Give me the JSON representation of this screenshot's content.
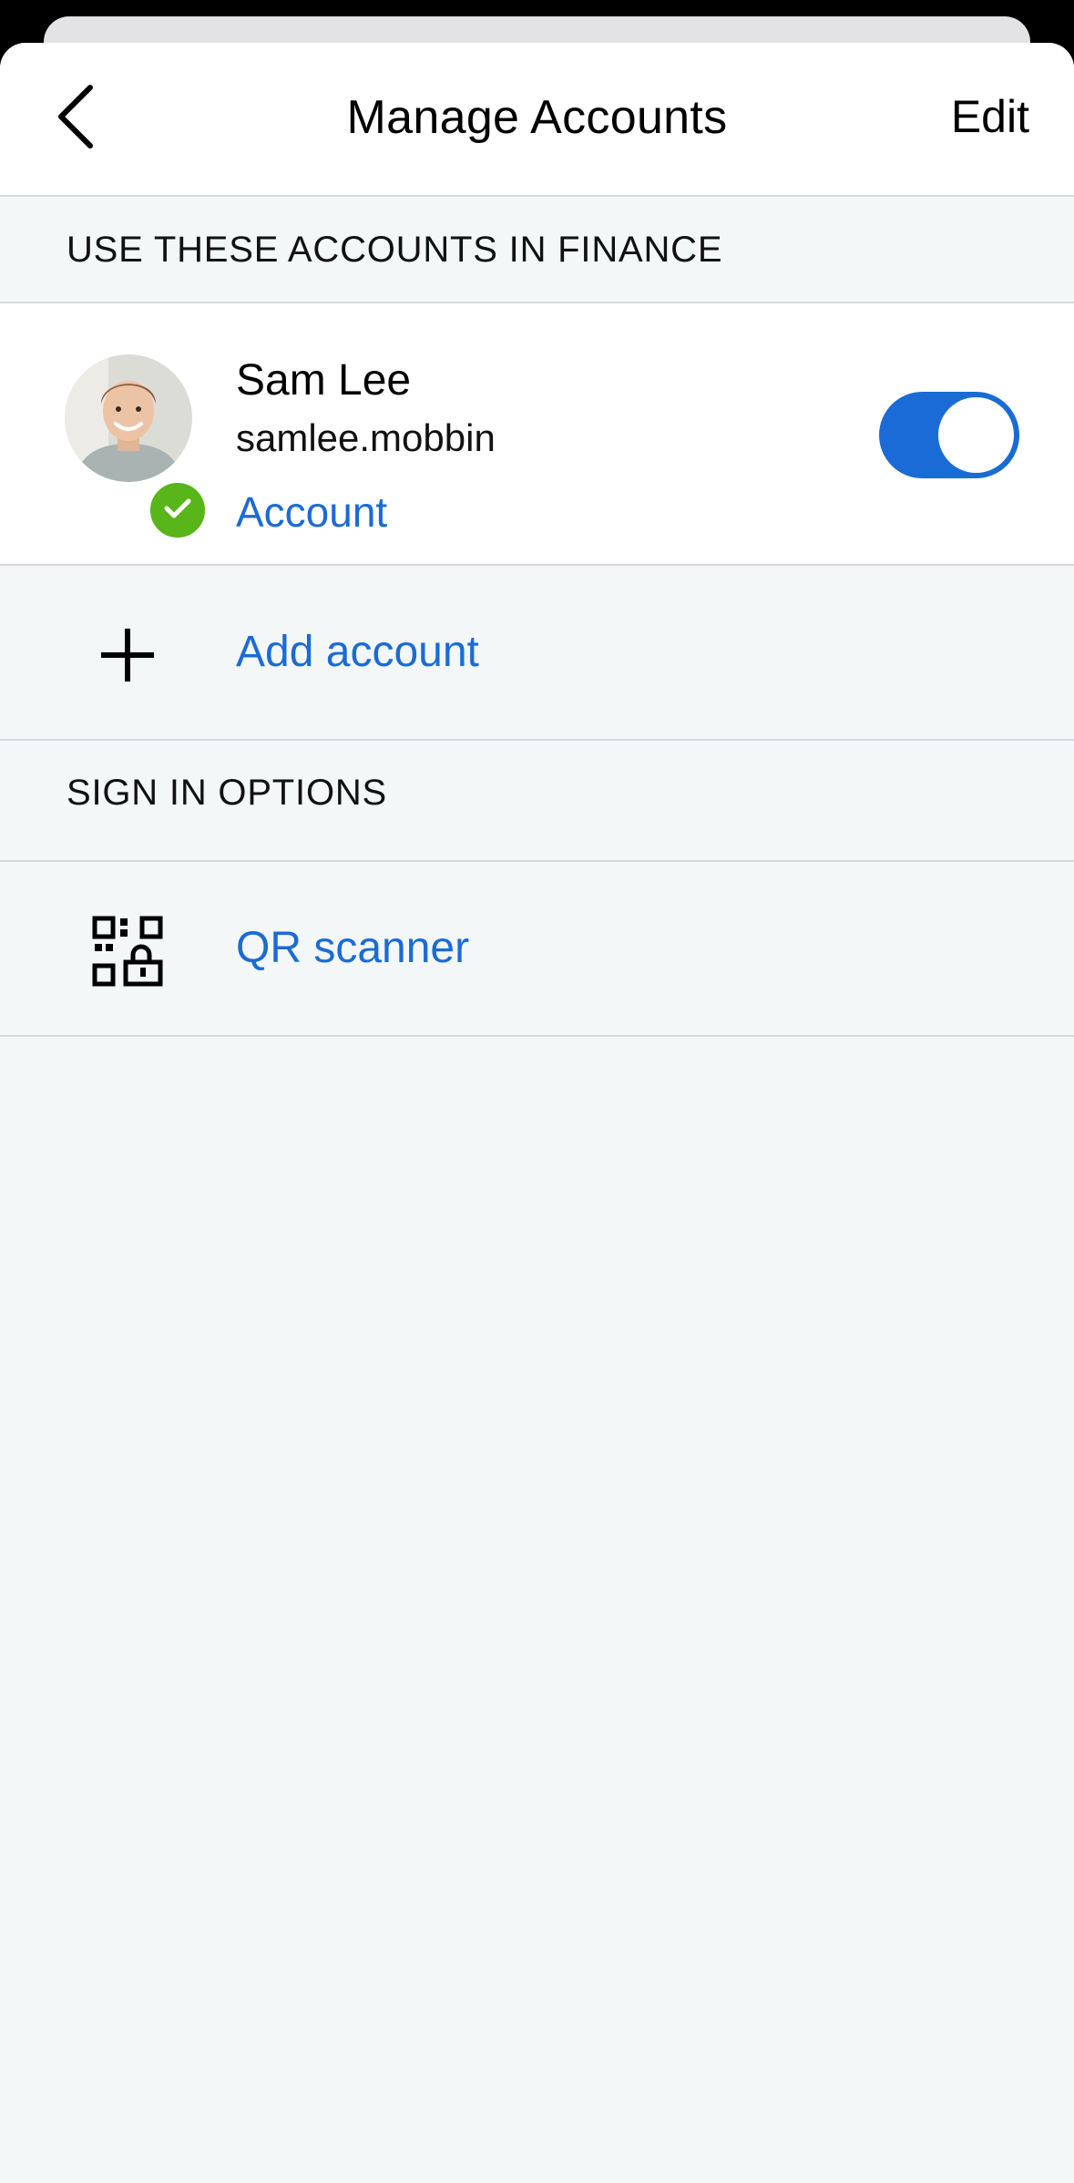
{
  "header": {
    "title": "Manage Accounts",
    "edit_label": "Edit"
  },
  "accounts_section": {
    "title": "USE THESE ACCOUNTS IN FINANCE"
  },
  "account": {
    "name": "Sam Lee",
    "username": "samlee.mobbin",
    "link_label": "Account",
    "enabled": true,
    "status": "verified"
  },
  "add_account": {
    "label": "Add account"
  },
  "sign_in_section": {
    "title": "SIGN IN OPTIONS"
  },
  "qr_scanner": {
    "label": "QR scanner"
  },
  "colors": {
    "accent": "#1b6bd6",
    "verified_badge": "#58b51a",
    "background": "#f3f7f8"
  },
  "icons": [
    "chevron-left-icon",
    "checkmark-icon",
    "plus-icon",
    "qr-code-lock-icon"
  ]
}
